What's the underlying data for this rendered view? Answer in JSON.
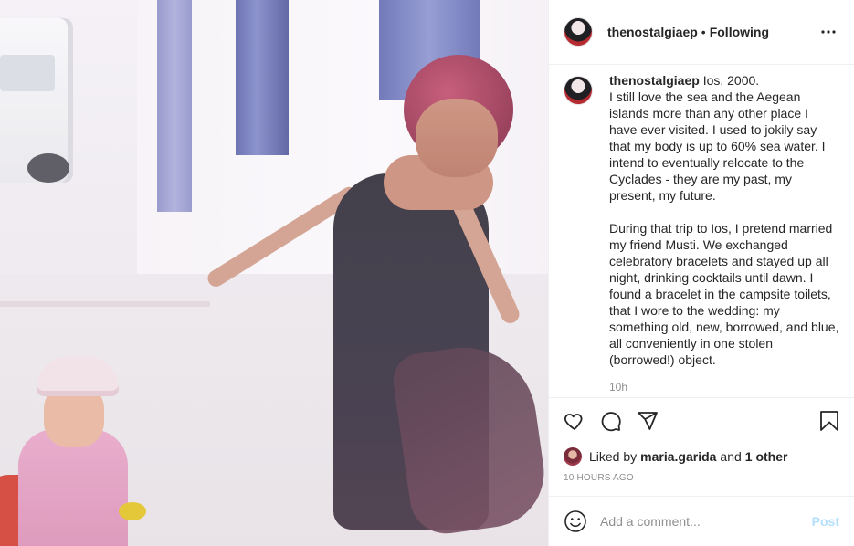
{
  "header": {
    "username": "thenostalgiaep",
    "separator": "•",
    "follow_state": "Following",
    "more_icon": "more-horizontal-icon"
  },
  "caption": {
    "username": "thenostalgiaep",
    "paragraph1": "Ios, 2000.\nI still love the sea and the Aegean islands more than any other place I have ever visited. I used to jokily say that my body is up to 60% sea water. I intend to eventually relocate to the Cyclades - they are my past, my present, my future.",
    "paragraph2": "During that trip to Ios, I pretend married my friend Musti. We exchanged celebratory bracelets and stayed up all night, drinking cocktails until dawn. I found a bracelet in the campsite toilets, that I wore to the wedding: my something old, new, borrowed, and blue, all conveniently in one stolen (borrowed!) object.",
    "time": "10h"
  },
  "actions": {
    "like_icon": "heart-icon",
    "comment_icon": "comment-icon",
    "share_icon": "share-icon",
    "save_icon": "bookmark-icon"
  },
  "likes": {
    "prefix": "Liked by",
    "liker": "maria.garida",
    "connector": "and",
    "others": "1 other"
  },
  "posted_ago": "10 HOURS AGO",
  "comment_box": {
    "placeholder": "Add a comment...",
    "post_label": "Post"
  },
  "colors": {
    "text": "#262626",
    "muted": "#8e8e8e",
    "border": "#efefef",
    "post_button_disabled": "#b2dffc"
  }
}
